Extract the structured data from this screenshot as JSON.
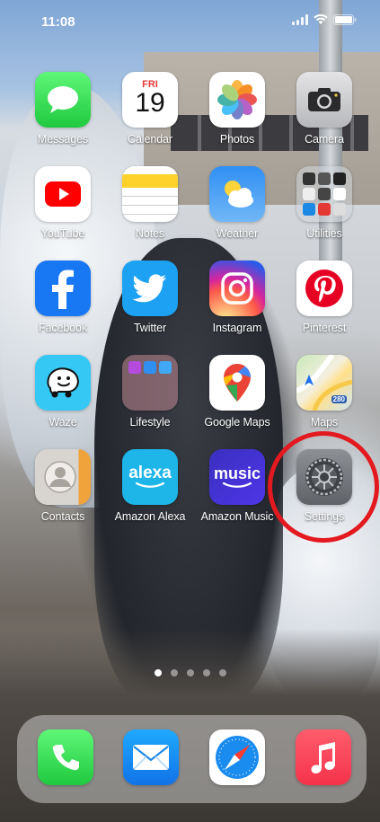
{
  "status_bar": {
    "time": "11:08"
  },
  "home_screen": {
    "apps": [
      {
        "id": "messages",
        "label": "Messages"
      },
      {
        "id": "calendar",
        "label": "Calendar",
        "day": "FRI",
        "date": "19"
      },
      {
        "id": "photos",
        "label": "Photos"
      },
      {
        "id": "camera",
        "label": "Camera"
      },
      {
        "id": "youtube",
        "label": "YouTube"
      },
      {
        "id": "notes",
        "label": "Notes"
      },
      {
        "id": "weather",
        "label": "Weather"
      },
      {
        "id": "utilities",
        "label": "Utilities"
      },
      {
        "id": "facebook",
        "label": "Facebook"
      },
      {
        "id": "twitter",
        "label": "Twitter"
      },
      {
        "id": "instagram",
        "label": "Instagram"
      },
      {
        "id": "pinterest",
        "label": "Pinterest"
      },
      {
        "id": "waze",
        "label": "Waze"
      },
      {
        "id": "lifestyle",
        "label": "Lifestyle"
      },
      {
        "id": "google-maps",
        "label": "Google Maps"
      },
      {
        "id": "maps",
        "label": "Maps",
        "badge": "280"
      },
      {
        "id": "contacts",
        "label": "Contacts"
      },
      {
        "id": "amazon-alexa",
        "label": "Amazon Alexa",
        "glyph": "alexa"
      },
      {
        "id": "amazon-music",
        "label": "Amazon Music",
        "glyph": "music"
      },
      {
        "id": "settings",
        "label": "Settings"
      }
    ],
    "highlighted_app": "settings",
    "highlight_color": "#e3191f",
    "page_dots": {
      "count": 5,
      "active_index": 0
    }
  },
  "dock": {
    "apps": [
      {
        "id": "phone",
        "label": "Phone"
      },
      {
        "id": "mail",
        "label": "Mail"
      },
      {
        "id": "safari",
        "label": "Safari"
      },
      {
        "id": "music",
        "label": "Music"
      }
    ]
  }
}
